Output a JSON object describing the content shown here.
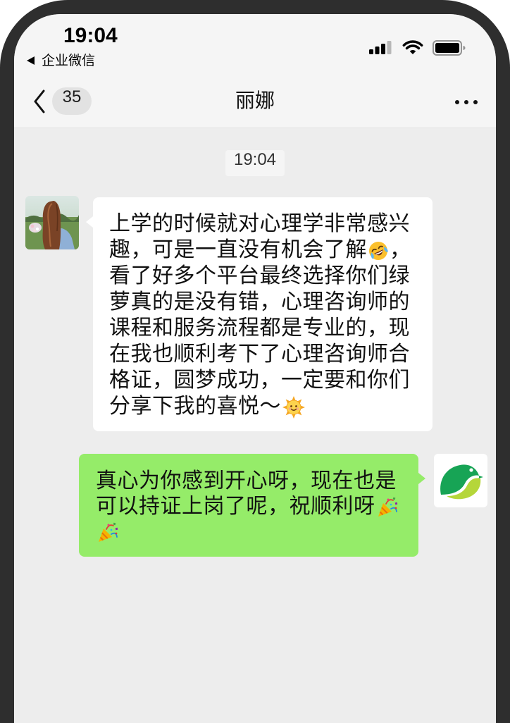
{
  "status_bar": {
    "time": "19:04",
    "back_app_label": "企业微信",
    "signal_bars": 3,
    "signal_bars_total": 4,
    "battery_level_percent": 100,
    "icons": [
      "back-triangle-icon",
      "cellular-signal-icon",
      "wifi-icon",
      "battery-icon"
    ]
  },
  "nav_bar": {
    "back_icon": "chevron-left-icon",
    "unread_count": "35",
    "title": "丽娜",
    "more_icon": "more-dots-icon"
  },
  "chat": {
    "timestamp": "19:04",
    "received_message": {
      "avatar_icon": "contact-avatar",
      "lines": [
        {
          "text": "上学的时候就对心理学非常感兴"
        },
        {
          "text": "趣，可是一直没有机会了解",
          "emoji": "rolling-on-the-floor-laughing-emoji",
          "after": "，"
        },
        {
          "text": "看了好多个平台最终选择你们绿"
        },
        {
          "text": "萝真的是没有错，心理咨询师的"
        },
        {
          "text": "课程和服务流程都是专业的，现"
        },
        {
          "text": "在我也顺利考下了心理咨询师合"
        },
        {
          "text": "格证，圆梦成功，一定要和你们"
        },
        {
          "text": "分享下我的喜悦～",
          "emoji": "sun-with-face-emoji"
        }
      ]
    },
    "sent_message": {
      "avatar_icon": "logo-avatar",
      "lines": [
        {
          "text": "真心为你感到开心呀，现在也是"
        },
        {
          "text": "可以持证上岗了呢，祝顺利呀",
          "emoji": "party-popper-emoji"
        },
        {
          "emoji": "party-popper-emoji"
        }
      ]
    }
  },
  "colors": {
    "frame": "#2e2e2e",
    "header_background": "#f5f5f5",
    "chat_background": "#ededed",
    "received_bubble": "#ffffff",
    "sent_bubble": "#95ec69",
    "logo_dark_green": "#17a455",
    "logo_lime": "#b5d63a"
  }
}
